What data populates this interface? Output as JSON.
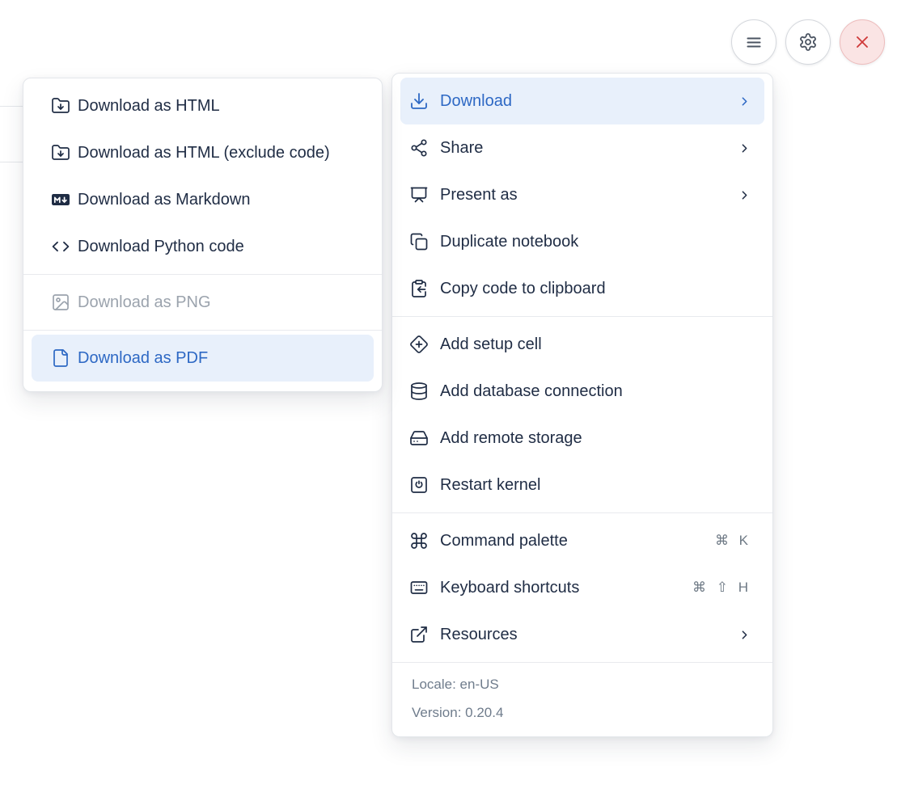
{
  "topbar": {
    "buttons": [
      {
        "name": "notebook-menu",
        "icon": "hamburger-icon"
      },
      {
        "name": "settings",
        "icon": "gear-icon"
      },
      {
        "name": "shutdown",
        "icon": "x-icon"
      }
    ]
  },
  "submenu": {
    "sections": [
      {
        "items": [
          {
            "label": "Download as HTML",
            "icon": "folder-down-icon"
          },
          {
            "label": "Download as HTML (exclude code)",
            "icon": "folder-down-icon"
          },
          {
            "label": "Download as Markdown",
            "icon": "markdown-icon"
          },
          {
            "label": "Download Python code",
            "icon": "code-icon"
          }
        ]
      },
      {
        "items": [
          {
            "label": "Download as PNG",
            "icon": "image-icon",
            "state": "disabled"
          }
        ]
      },
      {
        "items": [
          {
            "label": "Download as PDF",
            "icon": "file-icon",
            "state": "active"
          }
        ]
      }
    ]
  },
  "main_menu": {
    "sections": [
      {
        "items": [
          {
            "label": "Download",
            "icon": "download-icon",
            "state": "active",
            "has_submenu": true
          },
          {
            "label": "Share",
            "icon": "share-icon",
            "has_submenu": true
          },
          {
            "label": "Present as",
            "icon": "presentation-icon",
            "has_submenu": true
          },
          {
            "label": "Duplicate notebook",
            "icon": "copy-icon"
          },
          {
            "label": "Copy code to clipboard",
            "icon": "clipboard-copy-icon"
          }
        ]
      },
      {
        "items": [
          {
            "label": "Add setup cell",
            "icon": "diamond-plus-icon"
          },
          {
            "label": "Add database connection",
            "icon": "database-icon"
          },
          {
            "label": "Add remote storage",
            "icon": "hard-drive-icon"
          },
          {
            "label": "Restart kernel",
            "icon": "power-square-icon"
          }
        ]
      },
      {
        "items": [
          {
            "label": "Command palette",
            "icon": "command-icon",
            "shortcut": "⌘ K"
          },
          {
            "label": "Keyboard shortcuts",
            "icon": "keyboard-icon",
            "shortcut": "⌘ ⇧ H"
          },
          {
            "label": "Resources",
            "icon": "external-link-icon",
            "has_submenu": true
          }
        ]
      }
    ],
    "footer": {
      "locale": "Locale: en-US",
      "version": "Version: 0.20.4"
    }
  },
  "colors": {
    "accent_blue": "#2d68c4",
    "highlight_bg": "#e8f0fb",
    "text_dark": "#1f2c44",
    "text_muted": "#6f7c8c",
    "disabled": "#9ba3ad",
    "danger_red": "#cf3a3a",
    "danger_bg": "#fae4e4",
    "separator": "#e8eaee"
  }
}
